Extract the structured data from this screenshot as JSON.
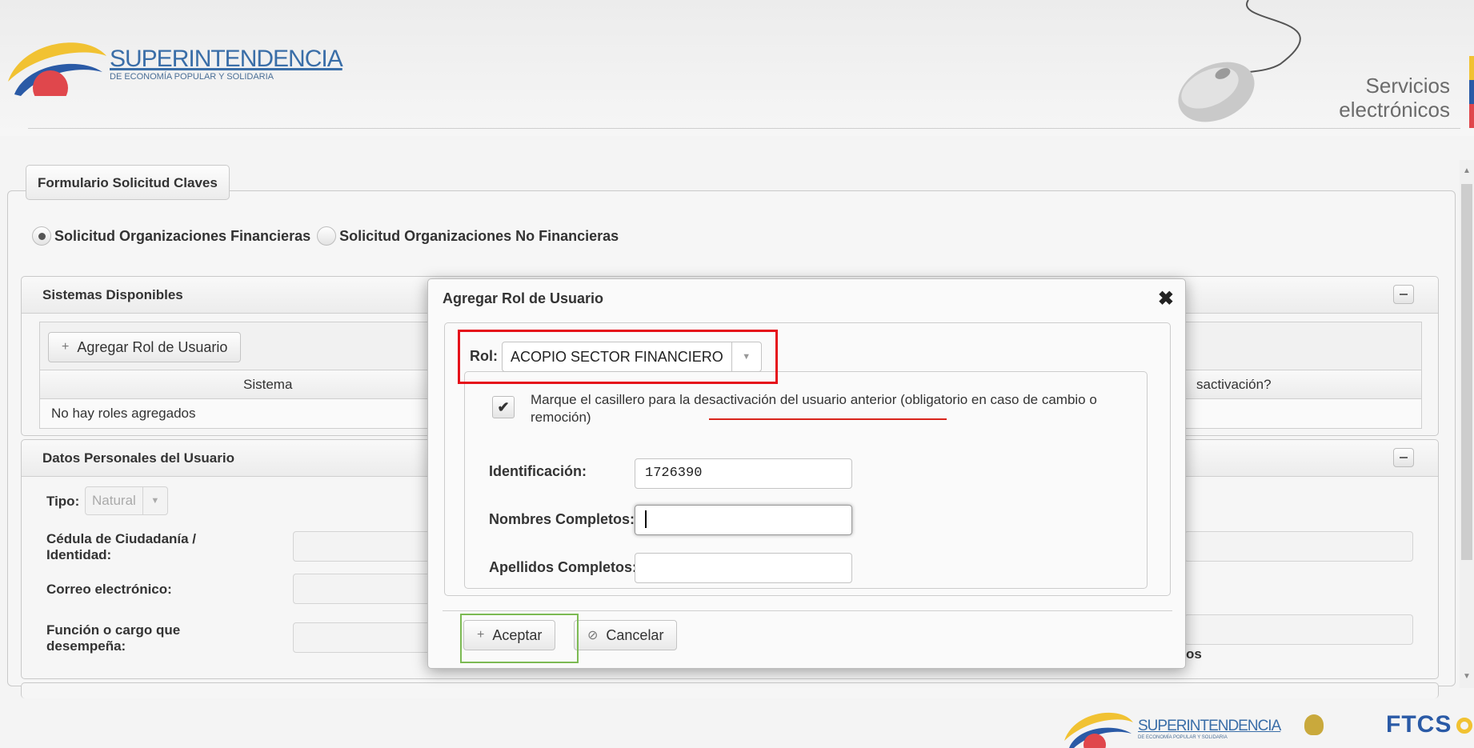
{
  "header": {
    "logo_line1": "SUPERINTENDENCIA",
    "logo_line2": "DE ECONOMÍA POPULAR Y SOLIDARIA",
    "services_line1": "Servicios",
    "services_line2": "electrónicos"
  },
  "form": {
    "legend": "Formulario Solicitud Claves",
    "radio_financieras": "Solicitud Organizaciones Financieras",
    "radio_no_financieras": "Solicitud Organizaciones No Financieras",
    "selected_radio": "financieras"
  },
  "sistemas": {
    "title": "Sistemas Disponibles",
    "add_button": "Agregar Rol de Usuario",
    "col_sistema": "Sistema",
    "col_desactivacion_partial": "sactivación?",
    "empty_row": "No hay roles agregados"
  },
  "datos": {
    "title": "Datos Personales del Usuario",
    "tipo_label": "Tipo:",
    "tipo_value": "Natural",
    "cedula_label": "Cédula de Ciudadanía / Identidad:",
    "correo_label": "Correo electrónico:",
    "funcion_label": "Función o cargo que desempeña:",
    "partial_text": "os"
  },
  "modal": {
    "title": "Agregar Rol de Usuario",
    "rol_label": "Rol:",
    "rol_value": "ACOPIO SECTOR FINANCIERO",
    "check_text_before": "Marque el casillero para la ",
    "check_text_link": "desactivación del usuario anterior",
    "check_text_after": " (obligatorio en caso de cambio o remoción)",
    "checked": true,
    "identificacion_label": "Identificación:",
    "identificacion_value": "1726390",
    "nombres_label": "Nombres Completos:",
    "nombres_value": "",
    "apellidos_label": "Apellidos Completos:",
    "apellidos_value": "",
    "accept_button": "Aceptar",
    "cancel_button": "Cancelar"
  },
  "footer": {
    "logo_line1": "SUPERINTENDENCIA",
    "logo_line2": "DE ECONOMÍA POPULAR Y SOLIDARIA",
    "ftcs": "FTCS"
  },
  "colors": {
    "highlight_red": "#e5101a",
    "highlight_green": "#7cba53",
    "logo_blue": "#3a6ea8"
  }
}
